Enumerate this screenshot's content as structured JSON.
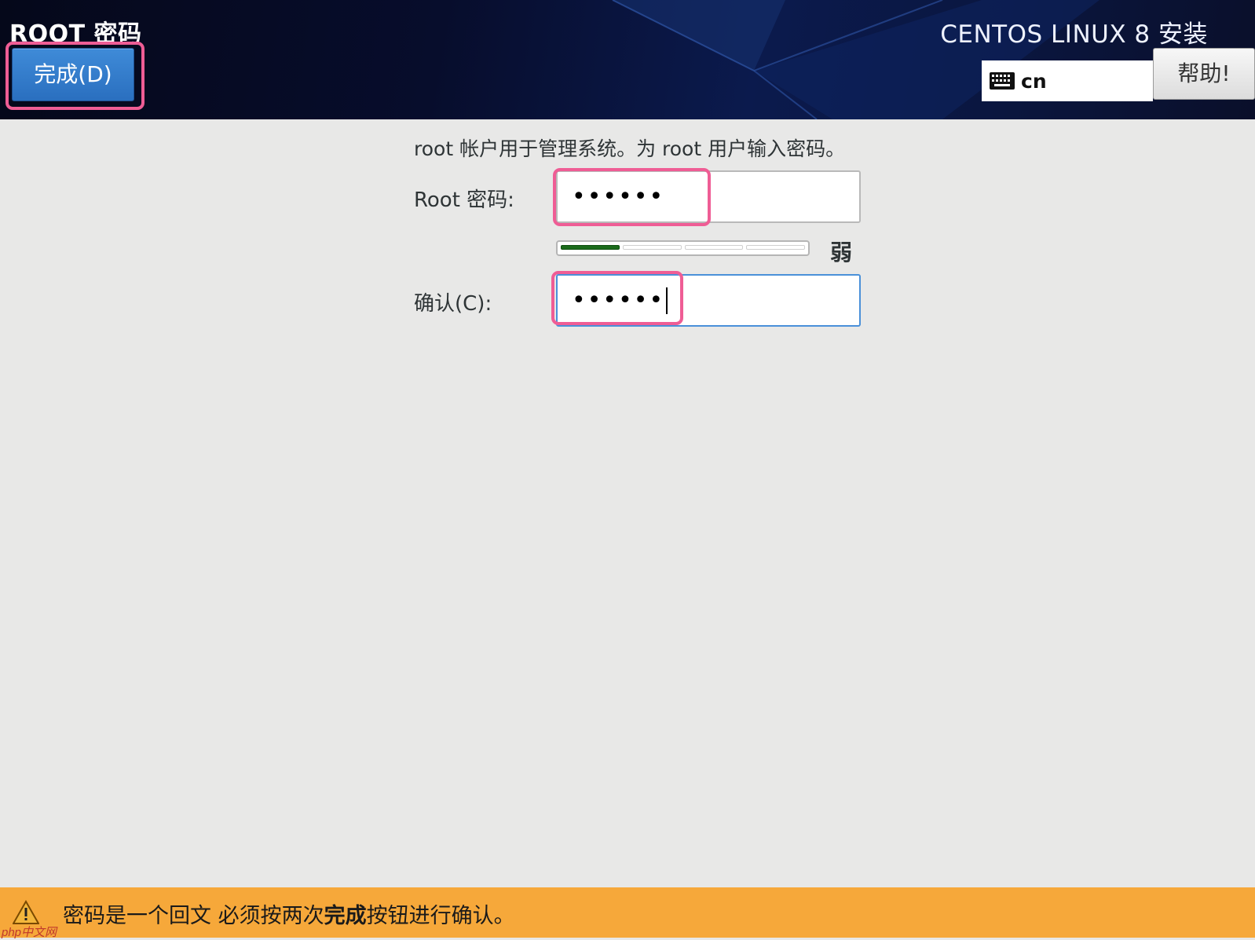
{
  "header": {
    "page_title": "ROOT 密码",
    "done_button": "完成(D)",
    "product_title": "CENTOS LINUX 8 安装",
    "keyboard_layout": "cn",
    "help_button": "帮助!"
  },
  "form": {
    "intro": "root 帐户用于管理系统。为 root 用户输入密码。",
    "root_password_label": "Root 密码:",
    "root_password_value": "••••••",
    "strength": {
      "label": "弱",
      "level": 1,
      "segments": 4
    },
    "confirm_label": "确认(C):",
    "confirm_value": "••••••"
  },
  "warning": {
    "text_part1": "密码是一个回文 必须按两次",
    "text_bold": "完成",
    "text_part2": "按钮进行确认。"
  },
  "watermark": "php中文网",
  "colors": {
    "accent_blue": "#2a6fbf",
    "highlight_pink": "#ef5d95",
    "warning_orange": "#f6a83a",
    "strength_green": "#1b6b1b"
  }
}
